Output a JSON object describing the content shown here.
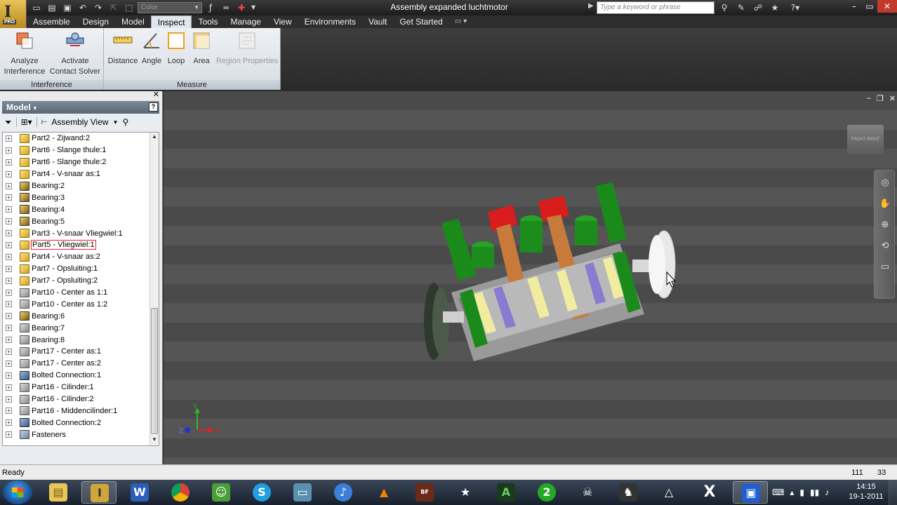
{
  "app": {
    "title": "Assembly expanded luchtmotor",
    "product_badge": "PRO",
    "color_placeholder": "Color",
    "search_placeholder": "Type a keyword or phrase"
  },
  "tabs": [
    "Assemble",
    "Design",
    "Model",
    "Inspect",
    "Tools",
    "Manage",
    "View",
    "Environments",
    "Vault",
    "Get Started"
  ],
  "active_tab": "Inspect",
  "ribbon": {
    "interference_panel": "Interference",
    "measure_panel": "Measure",
    "analyze_1": "Analyze",
    "analyze_2": "Interference",
    "activate_1": "Activate",
    "activate_2": "Contact Solver",
    "distance": "Distance",
    "angle": "Angle",
    "loop": "Loop",
    "area": "Area",
    "region": "Region Properties"
  },
  "browser": {
    "title": "Model",
    "view": "Assembly View",
    "items": [
      {
        "label": "Part2 - Zijwand:2",
        "icon": "part"
      },
      {
        "label": "Part6 - Slange thule:1",
        "icon": "part"
      },
      {
        "label": "Part6 - Slange thule:2",
        "icon": "part"
      },
      {
        "label": "Part4 - V-snaar as:1",
        "icon": "part"
      },
      {
        "label": "Bearing:2",
        "icon": "bearing"
      },
      {
        "label": "Bearing:3",
        "icon": "bearing"
      },
      {
        "label": "Bearing:4",
        "icon": "bearing"
      },
      {
        "label": "Bearing:5",
        "icon": "bearing"
      },
      {
        "label": "Part3 - V-snaar Vliegwiel:1",
        "icon": "part"
      },
      {
        "label": "Part5 - Vliegwiel:1",
        "icon": "part",
        "selected": true
      },
      {
        "label": "Part4 - V-snaar as:2",
        "icon": "part"
      },
      {
        "label": "Part7 - Opsluiting:1",
        "icon": "part"
      },
      {
        "label": "Part7 - Opsluiting:2",
        "icon": "part"
      },
      {
        "label": "Part10 - Center as 1:1",
        "icon": "grey"
      },
      {
        "label": "Part10 - Center as 1:2",
        "icon": "grey"
      },
      {
        "label": "Bearing:6",
        "icon": "bearing"
      },
      {
        "label": "Bearing:7",
        "icon": "grey"
      },
      {
        "label": "Bearing:8",
        "icon": "grey"
      },
      {
        "label": "Part17 - Center as:1",
        "icon": "grey"
      },
      {
        "label": "Part17 - Center as:2",
        "icon": "grey"
      },
      {
        "label": "Bolted Connection:1",
        "icon": "bolt"
      },
      {
        "label": "Part16 - Cilinder:1",
        "icon": "grey"
      },
      {
        "label": "Part16 - Cilinder:2",
        "icon": "grey"
      },
      {
        "label": "Part16 - Middencilinder:1",
        "icon": "grey"
      },
      {
        "label": "Bolted Connection:2",
        "icon": "bolt"
      },
      {
        "label": "Fasteners",
        "icon": "fast"
      }
    ]
  },
  "viewcube": {
    "front": "FRONT",
    "right": "RIGHT"
  },
  "triad": {
    "x": "X",
    "y": "Y",
    "z": "Z"
  },
  "status": {
    "text": "Ready",
    "n1": "111",
    "n2": "33"
  },
  "clock": {
    "time": "14:15",
    "date": "19-1-2011"
  },
  "colors": {
    "titlebar": "#1c1c1c",
    "ribbon": "#e3e8ee",
    "viewport_bg": "#4d4d4d",
    "model_green": "#1a8a1a",
    "model_red": "#d91c1c",
    "model_copper": "#c87a3a",
    "model_yellow": "#f1eca0",
    "model_violet": "#8a7ad0"
  }
}
